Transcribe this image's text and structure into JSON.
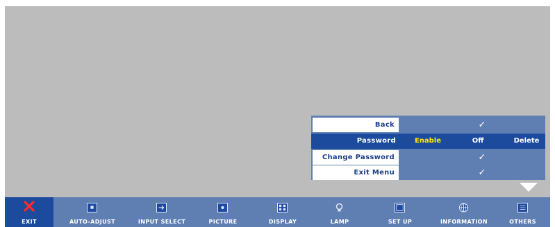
{
  "submenu": {
    "rows": [
      {
        "label": "Back",
        "value": "✓"
      },
      {
        "label": "Password",
        "options": [
          "Enable",
          "Off",
          "Delete"
        ],
        "selected_option": "Enable"
      },
      {
        "label": "Change Password",
        "value": "✓"
      },
      {
        "label": "Exit Menu",
        "value": "✓"
      }
    ]
  },
  "menubar": {
    "items": [
      {
        "label": "EXIT",
        "icon": "close-icon"
      },
      {
        "label": "AUTO-ADJUST",
        "icon": "auto-adjust-icon"
      },
      {
        "label": "INPUT SELECT",
        "icon": "input-select-icon"
      },
      {
        "label": "PICTURE",
        "icon": "picture-icon"
      },
      {
        "label": "DISPLAY",
        "icon": "display-icon"
      },
      {
        "label": "LAMP",
        "icon": "lamp-icon"
      },
      {
        "label": "SET UP",
        "icon": "setup-icon"
      },
      {
        "label": "INFORMATION",
        "icon": "information-icon"
      },
      {
        "label": "OTHERS",
        "icon": "others-icon"
      }
    ]
  },
  "colors": {
    "background": "#bcbcbc",
    "panel": "#5f7fb3",
    "selected": "#1c4b9e",
    "highlight_text": "#ffea00",
    "exit_icon": "#ff2a2a"
  }
}
